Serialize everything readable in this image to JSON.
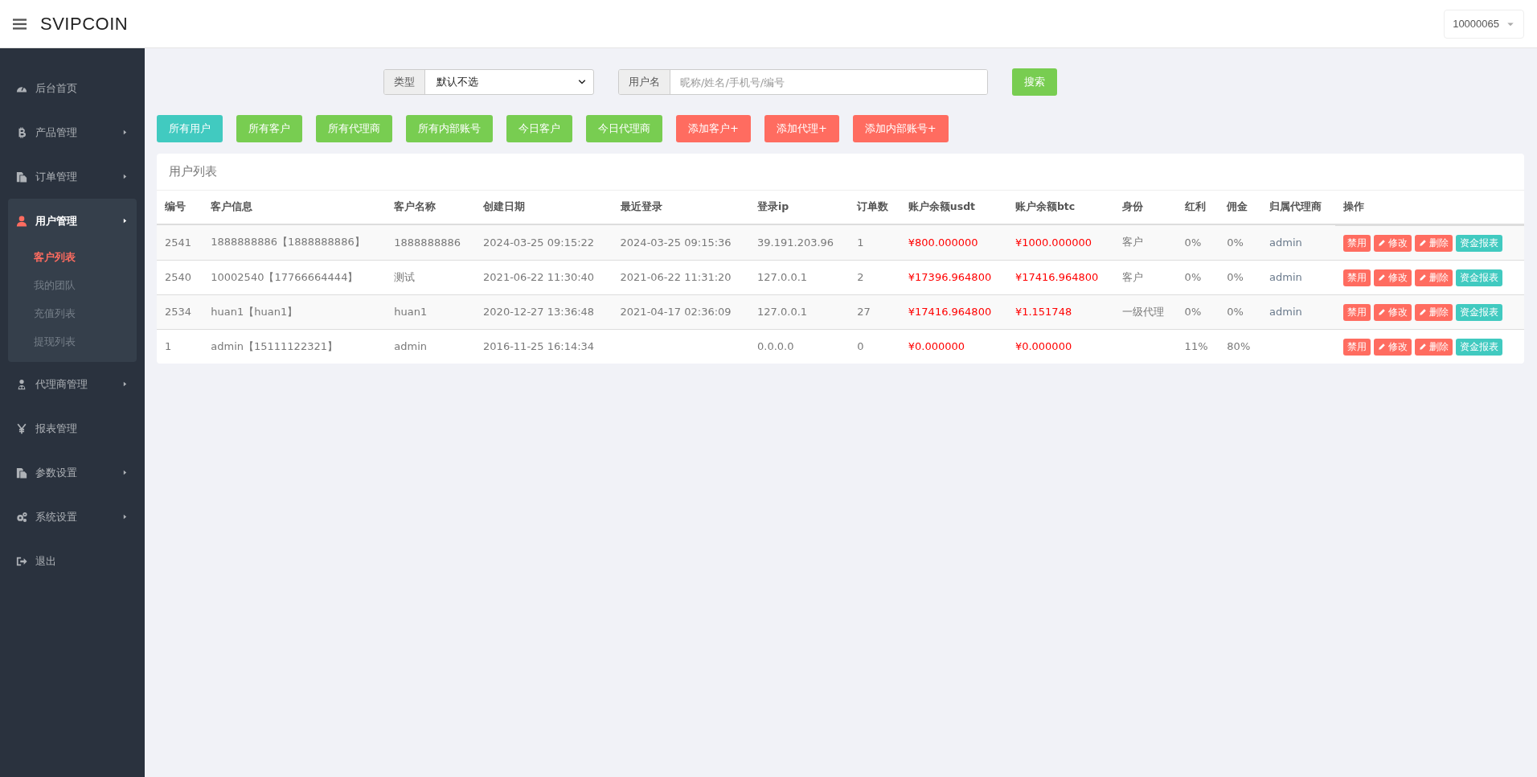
{
  "header": {
    "brand": "SVIPCOIN",
    "user": "10000065"
  },
  "sidebar": {
    "items": [
      {
        "label": "后台首页",
        "expandable": false,
        "expanded": false
      },
      {
        "label": "产品管理",
        "expandable": true,
        "expanded": false
      },
      {
        "label": "订单管理",
        "expandable": true,
        "expanded": false
      },
      {
        "label": "用户管理",
        "expandable": true,
        "expanded": true,
        "children": [
          {
            "label": "客户列表",
            "selected": true
          },
          {
            "label": "我的团队",
            "selected": false
          },
          {
            "label": "充值列表",
            "selected": false
          },
          {
            "label": "提现列表",
            "selected": false
          }
        ]
      },
      {
        "label": "代理商管理",
        "expandable": true,
        "expanded": false
      },
      {
        "label": "报表管理",
        "expandable": false,
        "expanded": false
      },
      {
        "label": "参数设置",
        "expandable": true,
        "expanded": false
      },
      {
        "label": "系统设置",
        "expandable": true,
        "expanded": false
      },
      {
        "label": "退出",
        "expandable": false,
        "expanded": false
      }
    ]
  },
  "filters": {
    "type_label": "类型",
    "type_value": "默认不选",
    "name_label": "用户名",
    "name_placeholder": "昵称/姓名/手机号/编号",
    "search_button": "搜索"
  },
  "quick_buttons": [
    {
      "label": "所有用户",
      "kind": "info"
    },
    {
      "label": "所有客户",
      "kind": "success"
    },
    {
      "label": "所有代理商",
      "kind": "success"
    },
    {
      "label": "所有内部账号",
      "kind": "success"
    },
    {
      "label": "今日客户",
      "kind": "success"
    },
    {
      "label": "今日代理商",
      "kind": "success"
    },
    {
      "label": "添加客户+",
      "kind": "danger"
    },
    {
      "label": "添加代理+",
      "kind": "danger"
    },
    {
      "label": "添加内部账号+",
      "kind": "danger"
    }
  ],
  "panel": {
    "title": "用户列表",
    "table": {
      "columns": [
        "编号",
        "客户信息",
        "客户名称",
        "创建日期",
        "最近登录",
        "登录ip",
        "订单数",
        "账户余额usdt",
        "账户余额btc",
        "身份",
        "红利",
        "佣金",
        "归属代理商",
        "操作"
      ],
      "rows": [
        {
          "id": "2541",
          "info": "1888888886【1888888886】",
          "name": "1888888886",
          "created": "2024-03-25 09:15:22",
          "last_login": "2024-03-25 09:15:36",
          "ip": "39.191.203.96",
          "orders": "1",
          "usdt": "¥800.000000",
          "btc": "¥1000.000000",
          "role": "客户",
          "bonus": "0%",
          "commission": "0%",
          "agent": "admin",
          "actions": [
            {
              "label": "禁用",
              "kind": "danger"
            },
            {
              "label": "修改",
              "kind": "danger"
            },
            {
              "label": "删除",
              "kind": "danger"
            },
            {
              "label": "资金报表",
              "kind": "info"
            }
          ]
        },
        {
          "id": "2540",
          "info": "10002540【17766664444】",
          "name": "测试",
          "created": "2021-06-22 11:30:40",
          "last_login": "2021-06-22 11:31:20",
          "ip": "127.0.0.1",
          "orders": "2",
          "usdt": "¥17396.964800",
          "btc": "¥17416.964800",
          "role": "客户",
          "bonus": "0%",
          "commission": "0%",
          "agent": "admin",
          "actions": [
            {
              "label": "禁用",
              "kind": "danger"
            },
            {
              "label": "修改",
              "kind": "danger"
            },
            {
              "label": "删除",
              "kind": "danger"
            },
            {
              "label": "资金报表",
              "kind": "info"
            }
          ]
        },
        {
          "id": "2534",
          "info": "huan1【huan1】",
          "name": "huan1",
          "created": "2020-12-27 13:36:48",
          "last_login": "2021-04-17 02:36:09",
          "ip": "127.0.0.1",
          "orders": "27",
          "usdt": "¥17416.964800",
          "btc": "¥1.151748",
          "role": "一级代理",
          "bonus": "0%",
          "commission": "0%",
          "agent": "admin",
          "actions": [
            {
              "label": "禁用",
              "kind": "danger"
            },
            {
              "label": "修改",
              "kind": "danger"
            },
            {
              "label": "删除",
              "kind": "danger"
            },
            {
              "label": "资金报表",
              "kind": "info"
            }
          ]
        },
        {
          "id": "1",
          "info": "admin【15111122321】",
          "name": "admin",
          "created": "2016-11-25 16:14:34",
          "ip": "0.0.0.0",
          "orders": "0",
          "usdt": "¥0.000000",
          "btc": "¥0.000000",
          "bonus": "11%",
          "commission": "80%",
          "actions": [
            {
              "label": "禁用",
              "kind": "danger"
            },
            {
              "label": "修改",
              "kind": "danger"
            },
            {
              "label": "删除",
              "kind": "danger"
            },
            {
              "label": "资金报表",
              "kind": "info"
            }
          ]
        }
      ]
    }
  }
}
